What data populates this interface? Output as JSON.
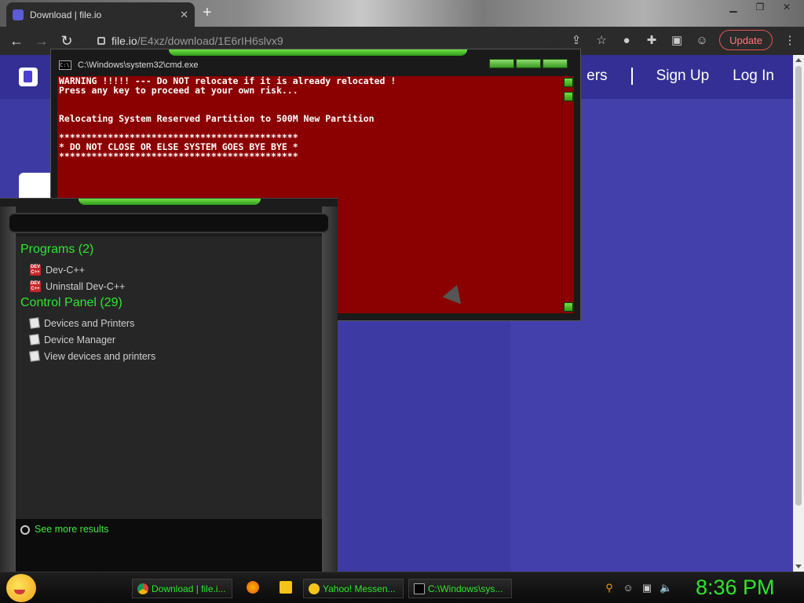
{
  "browser": {
    "tab_title": "Download | file.io",
    "url_host": "file.io",
    "url_path": "/E4xz/download/1E6rIH6slvx9",
    "update_label": "Update"
  },
  "site": {
    "nav_partial": "ers",
    "sign_up": "Sign Up",
    "log_in": "Log In"
  },
  "cmd": {
    "title": "C:\\Windows\\system32\\cmd.exe",
    "icon_text": "C:\\.",
    "output": "WARNING !!!!! --- Do NOT relocate if it is already relocated !\nPress any key to proceed at your own risk...\n\n\nRelocating System Reserved Partition to 500M New Partition\n\n********************************************\n* DO NOT CLOSE OR ELSE SYSTEM GOES BYE BYE *\n********************************************"
  },
  "start_menu": {
    "groups": [
      {
        "heading": "Programs (2)",
        "items": [
          "Dev-C++",
          "Uninstall Dev-C++"
        ]
      },
      {
        "heading": "Control Panel (29)",
        "items": [
          "Devices and Printers",
          "Device Manager",
          "View devices and printers"
        ]
      }
    ],
    "see_more": "See more results"
  },
  "taskbar": {
    "buttons": [
      "Download | file.i...",
      "Yahoo! Messen...",
      "C:\\Windows\\sys..."
    ],
    "clock": "8:36 PM"
  },
  "colors": {
    "accent_green": "#2ee62e",
    "console_bg": "#8b0000",
    "site_bg": "#3d3ba3"
  }
}
